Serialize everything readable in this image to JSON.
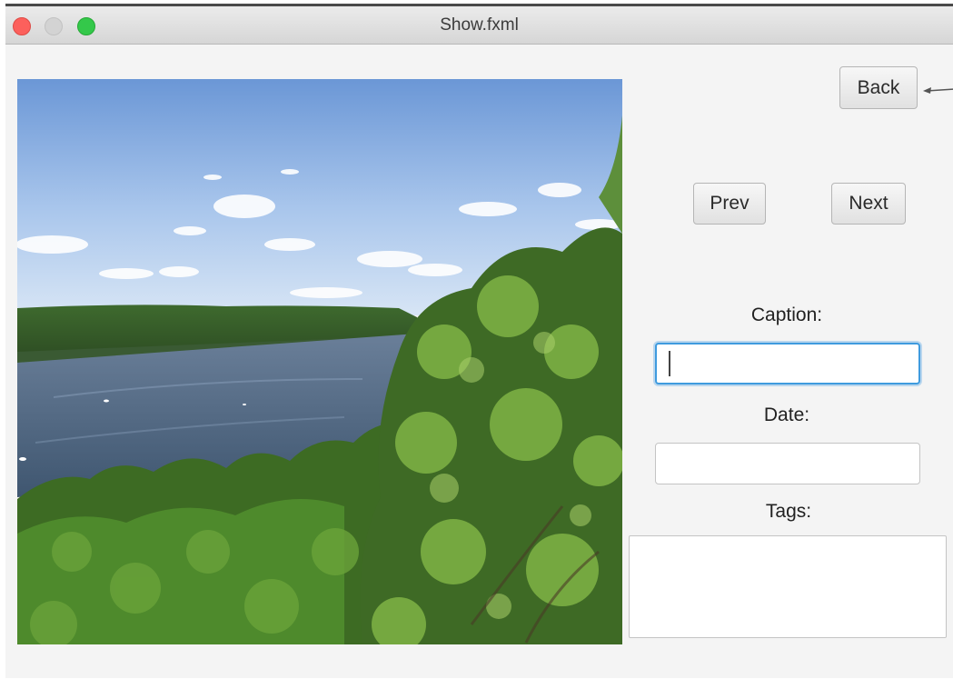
{
  "window": {
    "title": "Show.fxml"
  },
  "photo": {
    "description_icon": "landscape-photo"
  },
  "navigation": {
    "back_label": "Back",
    "prev_label": "Prev",
    "next_label": "Next"
  },
  "form": {
    "caption_label": "Caption:",
    "caption_value": "",
    "date_label": "Date:",
    "date_value": "",
    "tags_label": "Tags:",
    "tags_value": ""
  },
  "colors": {
    "close": "#fc605c",
    "minimize": "#d3d3d3",
    "maximize": "#34c84a",
    "focus_ring": "#3f9bde"
  }
}
